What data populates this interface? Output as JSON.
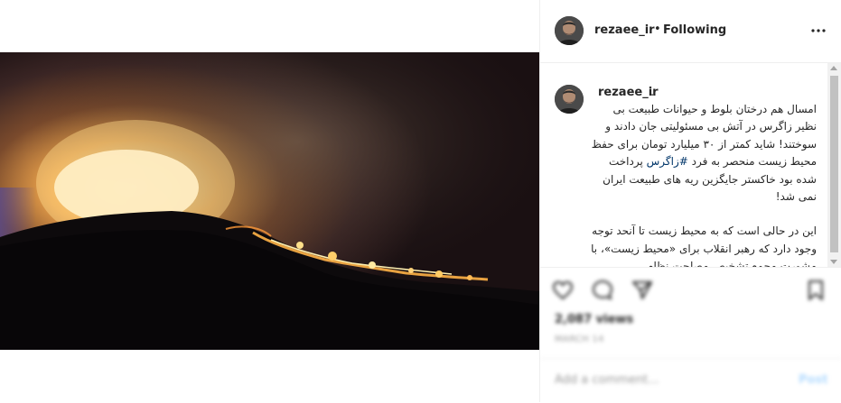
{
  "post": {
    "photo_alt": "wildfire burning on hillside at night"
  },
  "header": {
    "username": "rezaee_ir",
    "separator": "•",
    "follow_status": "Following",
    "more_icon": "more-options-icon"
  },
  "caption": {
    "username": "rezaee_ir",
    "username_suffix": ".",
    "paragraph1_before": "امسال هم درختان بلوط و حیوانات طبیعت بی نظیر زاگرس در آتش بی مسئولیتی جان دادند و سوختند! شاید کمتر از ۳۰ میلیارد تومان برای حفظ محیط زیست منحصر به فرد ",
    "hashtag": "#زاگرس",
    "paragraph1_after": " پرداخت شده بود خاکستر جایگزین ریه های طبیعت ایران نمی شد!",
    "paragraph2": "این در حالی است که به محیط زیست تا آنحد توجه وجود دارد که رهبر انقلاب برای «محیط زیست»، با مشورت مجمع تشخیص مصلحت نظام، سیاست‌های کلی تعیین و ابلاغ فرموده‌اند."
  },
  "actions": {
    "like_icon": "heart-icon",
    "comment_icon": "comment-icon",
    "share_icon": "share-icon",
    "save_icon": "bookmark-icon",
    "likes": "2,087 views",
    "date": "MARCH 14",
    "add_comment_placeholder": "Add a comment...",
    "post_label": "Post"
  },
  "colors": {
    "accent_blue": "#0095f6",
    "post_button_disabled": "#b3dbff",
    "hashtag": "#003569",
    "border": "#efefef"
  }
}
